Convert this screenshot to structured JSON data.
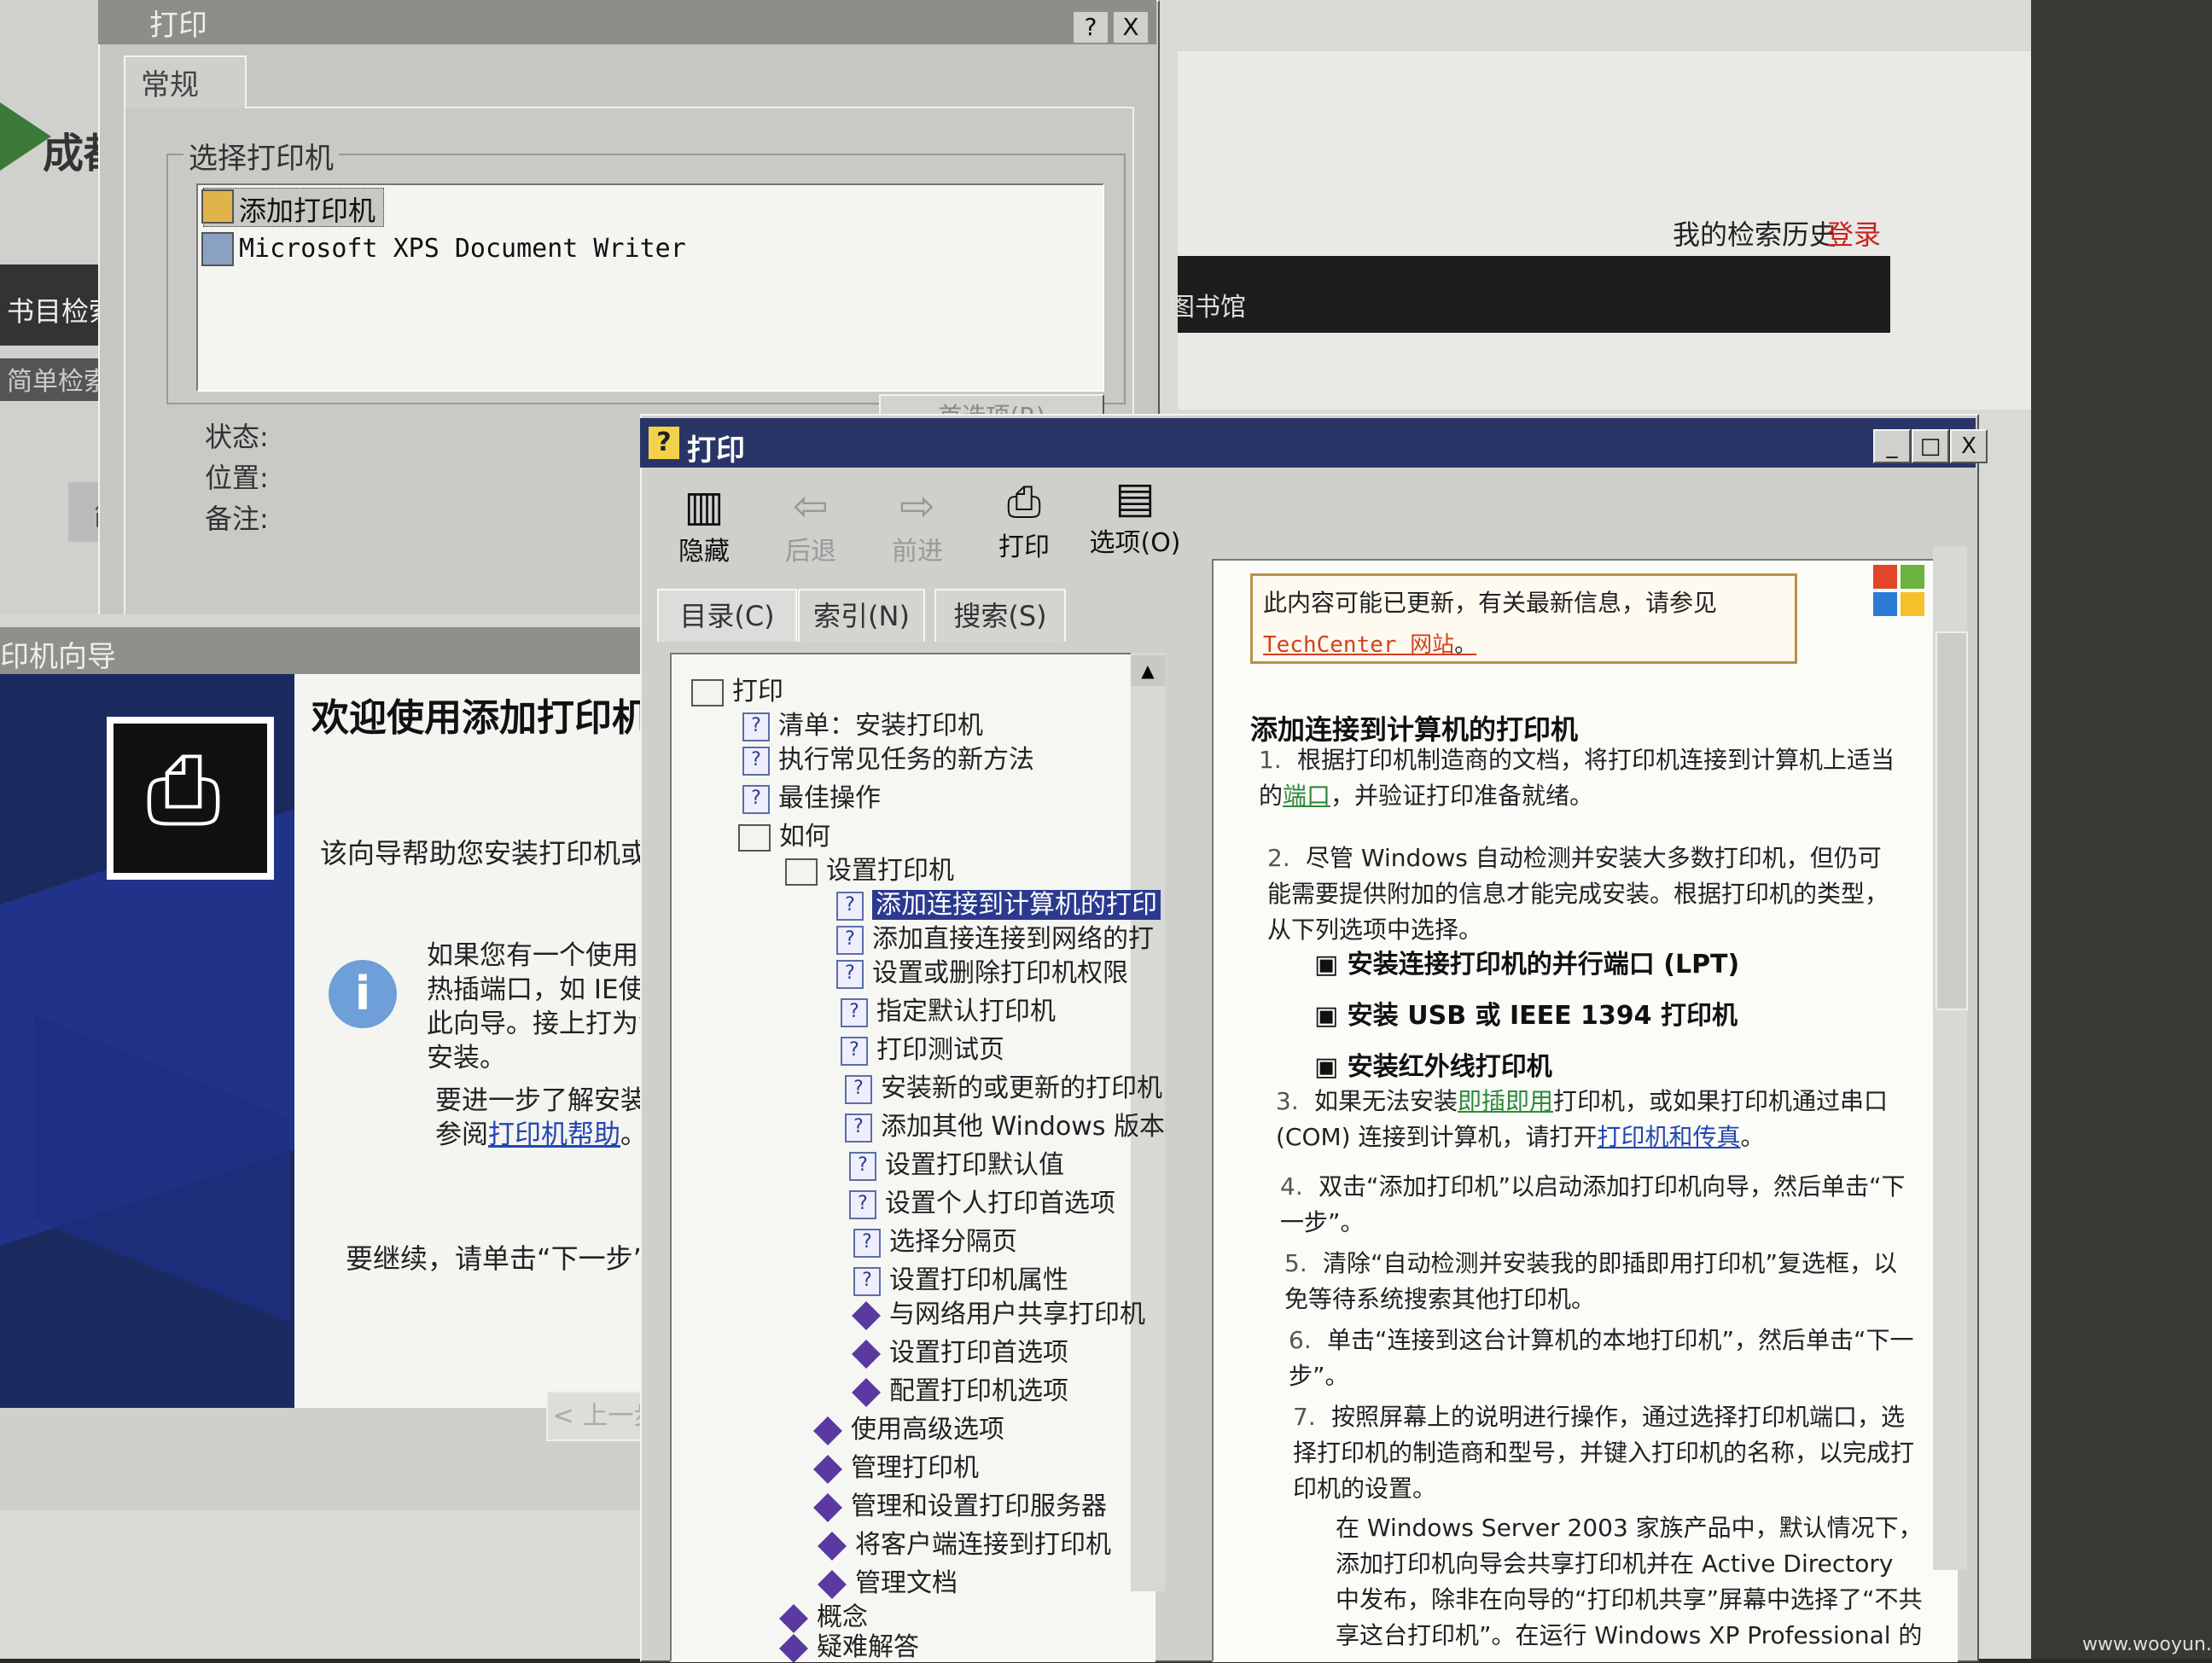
{
  "background_page": {
    "site_title_partial": "成都",
    "history_link": "我的检索历史",
    "login_link": "登录",
    "nav_bar_text": "图书馆",
    "nav_left_1": "书目检索",
    "nav_left_2": "简单检索",
    "tab_partial": "简"
  },
  "props_dialog": {
    "title": "打印",
    "help_btn": "?",
    "close_btn": "X",
    "tab_general": "常规",
    "group_label": "选择打印机",
    "printers": [
      "添加打印机",
      "Microsoft XPS Document Writer"
    ],
    "status_label": "状态:",
    "location_label": "位置:",
    "comment_label": "备注:",
    "prefs_button": "首选项(R)"
  },
  "wizard": {
    "title": "印机向导",
    "heading": "欢迎使用添加打印机",
    "desc": "该向导帮助您安装打印机或",
    "para1": "如果您有一个使用以热插端口，如 IE使用此向导。接上打为您安装。",
    "para2_prefix": "要进一步了解安装打参阅",
    "para2_link": "打印机帮助",
    "para2_suffix": "。",
    "continue_text": "要继续，请单击“下一步”",
    "back_button": "< 上一步(B)"
  },
  "help": {
    "title": "打印",
    "min": "_",
    "max": "□",
    "close": "X",
    "toolbar": {
      "hide": "隐藏",
      "back": "后退",
      "forward": "前进",
      "print": "打印",
      "options": "选项(O)"
    },
    "tabs": {
      "contents": "目录(C)",
      "index": "索引(N)",
      "search": "搜索(S)"
    },
    "tree": {
      "root": "打印",
      "checklist": "清单：安装打印机",
      "common_tasks": "执行常见任务的新方法",
      "best_practices": "最佳操作",
      "howto": "如何",
      "setup": "设置打印机",
      "setup_items": [
        "添加连接到计算机的打印",
        "添加直接连接到网络的打",
        "设置或删除打印机权限",
        "指定默认打印机",
        "打印测试页",
        "安装新的或更新的打印机",
        "添加其他 Windows 版本",
        "设置打印默认值",
        "设置个人打印首选项",
        "选择分隔页",
        "设置打印机属性"
      ],
      "setup_books": [
        "与网络用户共享打印机",
        "设置打印首选项",
        "配置打印机选项"
      ],
      "howto_books": [
        "使用高级选项",
        "管理打印机",
        "管理和设置打印服务器",
        "将客户端连接到打印机",
        "管理文档"
      ],
      "concepts": "概念",
      "troubleshoot": "疑难解答"
    },
    "content": {
      "notice": "此内容可能已更新，有关最新信息，请参见",
      "notice_link": "TechCenter 网站",
      "notice_end": "。",
      "heading": "添加连接到计算机的打印机",
      "step1_a": "根据打印机制造商的文档，将打印机连接到计算机上适当的",
      "step1_link": "端口",
      "step1_b": "，并验证打印准备就绪。",
      "step2": "尽管 Windows 自动检测并安装大多数打印机，但仍可能需要提供附加的信息才能完成安装。根据打印机的类型，从下列选项中选择。",
      "opt1": "安装连接打印机的并行端口 (LPT)",
      "opt2": "安装 USB 或 IEEE 1394 打印机",
      "opt3": "安装红外线打印机",
      "step3_a": "如果无法安装",
      "step3_link1": "即插即用",
      "step3_b": "打印机，或如果打印机通过串口 (COM) 连接到计算机，请打开",
      "step3_link2": "打印机和传真",
      "step3_c": "。",
      "step4": "双击“添加打印机”以启动添加打印机向导，然后单击“下一步”。",
      "step5": "清除“自动检测并安装我的即插即用打印机”复选框，以免等待系统搜索其他打印机。",
      "step6": "单击“连接到这台计算机的本地打印机”，然后单击“下一步”。",
      "step7": "按照屏幕上的说明进行操作，通过选择打印机端口，选择打印机的制造商和型号，并键入打印机的名称，以完成打印机的设置。",
      "note": "在 Windows Server 2003 家族产品中，默认情况下，添加打印机向导会共享打印机并在 Active Directory 中发布，除非在向导的“打印机共享”屏幕中选择了“不共享这台打印机”。在运行 Windows XP Professional 的计"
    }
  },
  "watermark": "www.wooyun.org",
  "colors": {
    "help_title_bar": "#2a3567",
    "wizard_side": "#1b2a5e",
    "link_blue": "#2347b0",
    "link_orange": "#d2421c"
  }
}
